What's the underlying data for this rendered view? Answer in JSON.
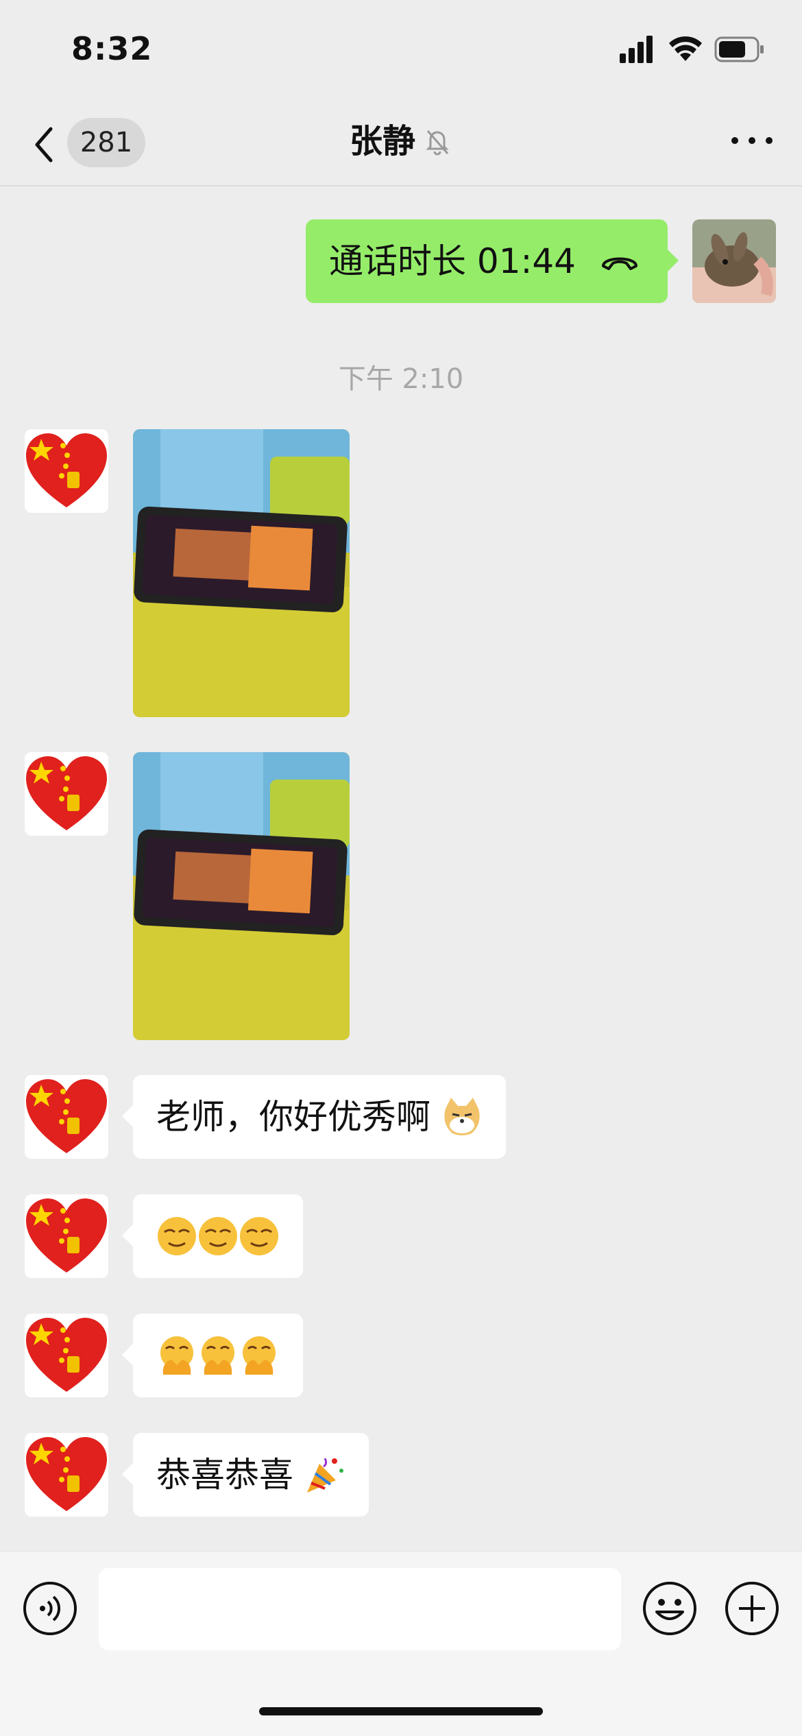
{
  "status_bar": {
    "time": "8:32"
  },
  "nav": {
    "back_label": "281",
    "title": "张静"
  },
  "messages": {
    "call": {
      "text": "通话时长 01:44"
    },
    "timestamp": "下午 2:10",
    "text1": "老师，你好优秀啊",
    "text2": "",
    "text3": "",
    "text4": "恭喜恭喜"
  },
  "colors": {
    "outgoing_bubble": "#95ec69",
    "background": "#ededed"
  },
  "icons": [
    "back-chevron-icon",
    "mute-bell-icon",
    "more-icon",
    "phone-hangup-icon",
    "voice-icon",
    "emoji-icon",
    "plus-icon"
  ]
}
